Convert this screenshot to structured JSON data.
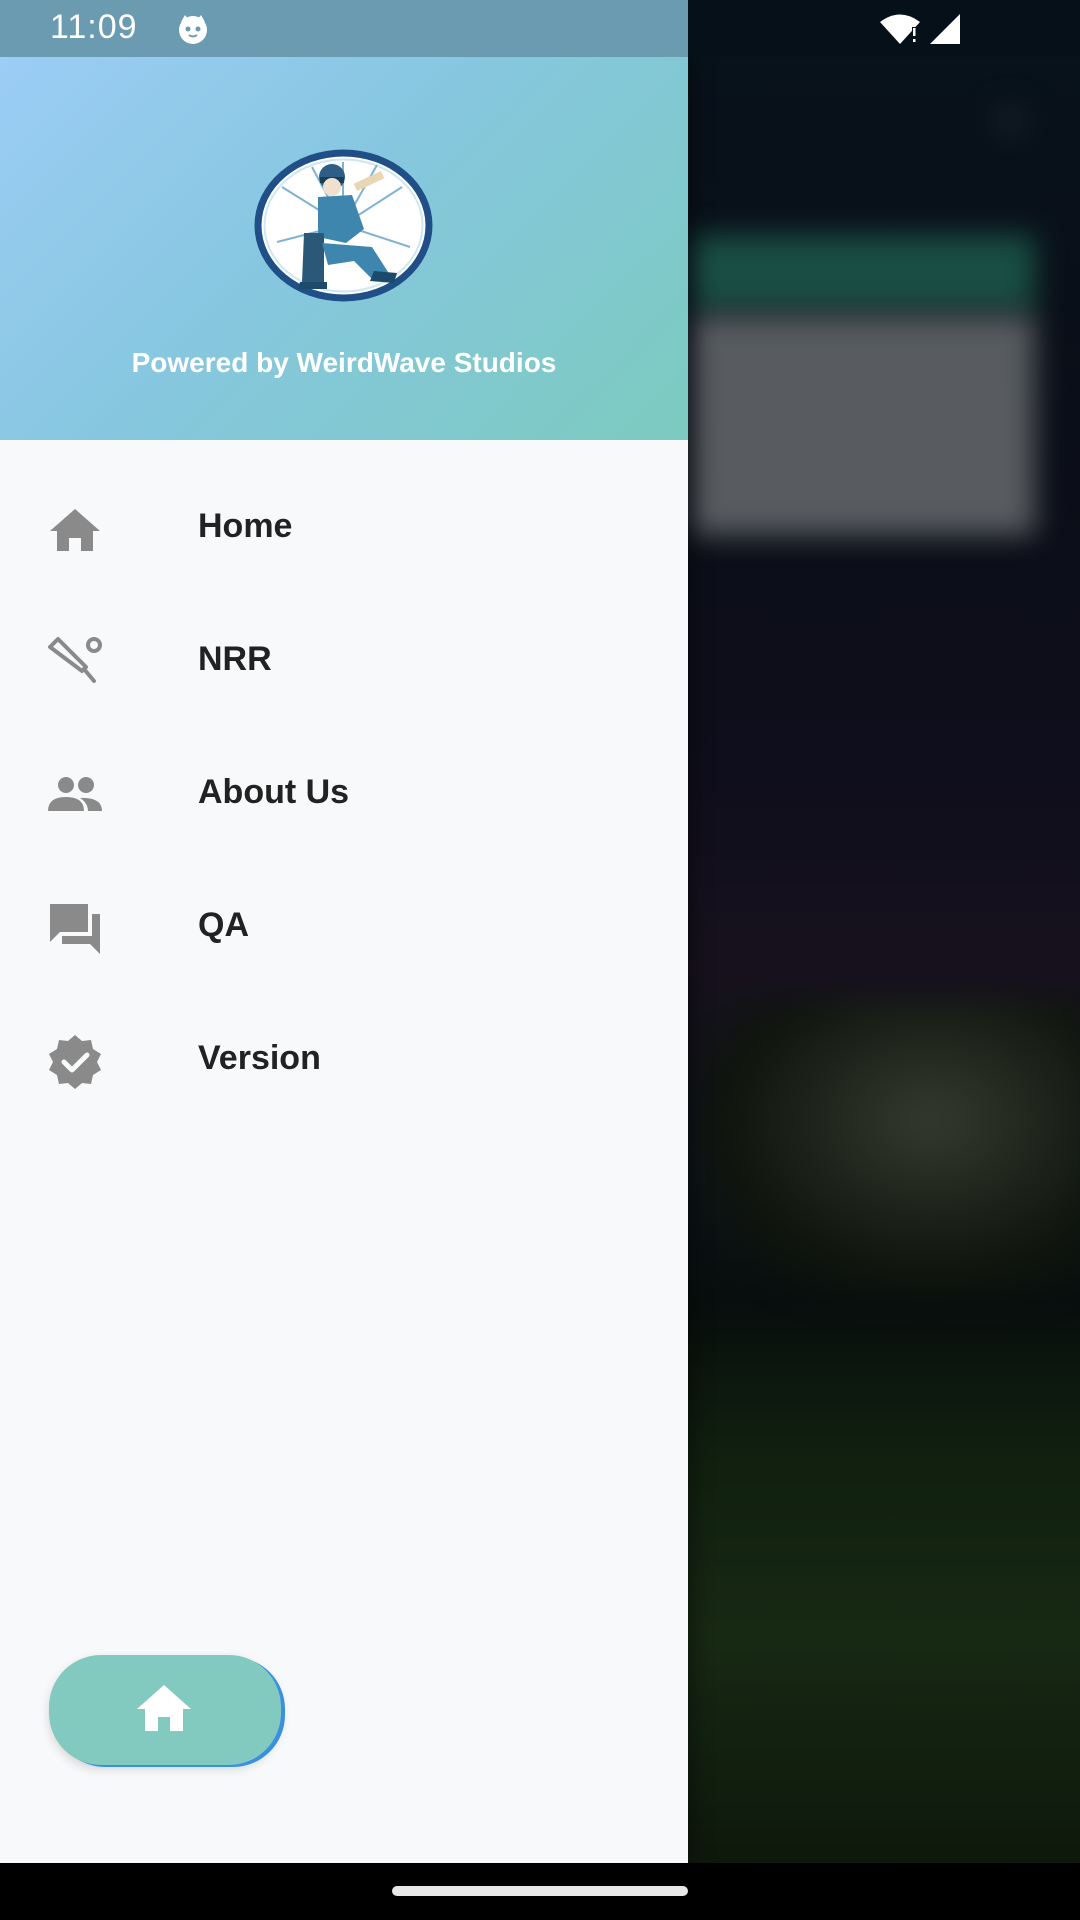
{
  "status_bar": {
    "time": "11:09",
    "icons": [
      "cat-icon",
      "wifi-alert-icon",
      "signal-icon"
    ]
  },
  "drawer": {
    "header": {
      "logo_icon": "cricket-batsman-logo",
      "powered_by": "Powered by WeirdWave Studios"
    },
    "menu": [
      {
        "icon": "home-icon",
        "label": "Home"
      },
      {
        "icon": "cricket-bat-icon",
        "label": "NRR"
      },
      {
        "icon": "people-icon",
        "label": "About Us"
      },
      {
        "icon": "forum-icon",
        "label": "QA"
      },
      {
        "icon": "verified-badge-icon",
        "label": "Version"
      }
    ],
    "home_button": {
      "icon": "home-icon"
    }
  },
  "colors": {
    "header_gradient_start": "#9ccdf5",
    "header_gradient_end": "#7ccabf",
    "menu_icon": "#8a8a8a",
    "fab_bg": "#82c9c0",
    "fab_border": "#3a8fe0"
  }
}
